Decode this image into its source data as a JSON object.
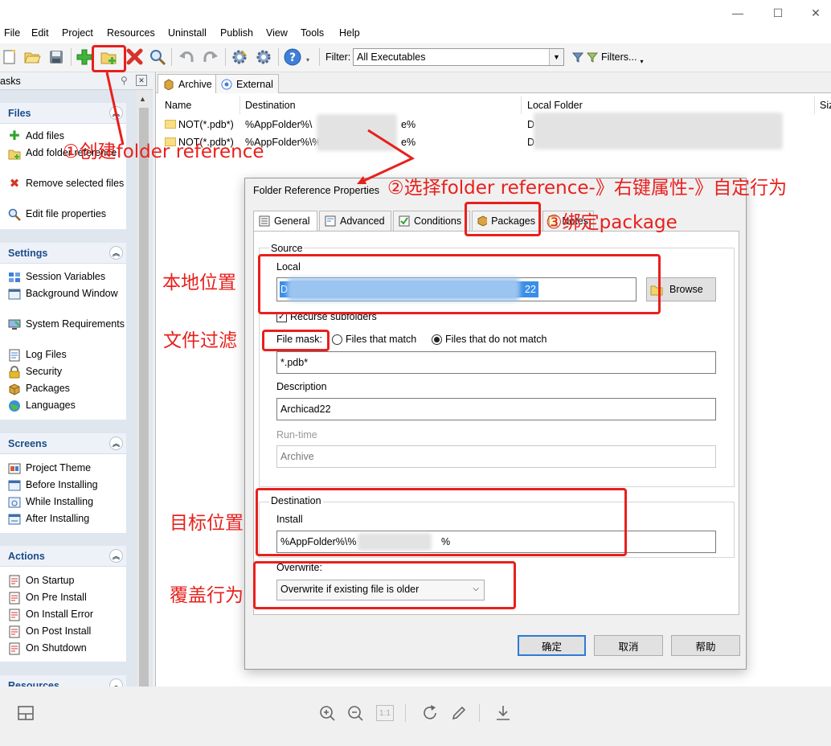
{
  "window": {
    "minimize_glyph": "—",
    "maximize_glyph": "☐",
    "close_glyph": "✕"
  },
  "menu": [
    "File",
    "Edit",
    "Project",
    "Resources",
    "Uninstall",
    "Publish",
    "View",
    "Tools",
    "Help"
  ],
  "toolbar": {
    "filter_label": "Filter:",
    "filter_value": "All Executables",
    "filters_button": "Filters...",
    "icons": [
      "new-project-icon",
      "open-icon",
      "save-icon",
      "add-files-icon",
      "add-folder-reference-icon",
      "remove-icon",
      "edit-properties-icon",
      "undo-icon",
      "redo-icon",
      "build-icon",
      "settings-icon",
      "help-icon"
    ]
  },
  "sidebar": {
    "header": "asks",
    "groups": {
      "files": {
        "title": "Files",
        "items": [
          "Add files",
          "Add folder reference",
          "Remove selected files",
          "Edit file properties"
        ]
      },
      "settings": {
        "title": "Settings",
        "items": [
          "Session Variables",
          "Background Window",
          "System Requirements",
          "Log Files",
          "Security",
          "Packages",
          "Languages"
        ]
      },
      "screens": {
        "title": "Screens",
        "items": [
          "Project Theme",
          "Before Installing",
          "While Installing",
          "After Installing"
        ]
      },
      "actions": {
        "title": "Actions",
        "items": [
          "On Startup",
          "On Pre Install",
          "On Install Error",
          "On Post Install",
          "On Shutdown"
        ]
      },
      "resources": {
        "title": "Resources"
      }
    }
  },
  "main": {
    "tabs": [
      "Archive",
      "External"
    ],
    "columns": [
      "Name",
      "Destination",
      "Local Folder",
      "Siz"
    ],
    "rows": [
      {
        "name": "NOT(*.pdb*)",
        "destination_start": "%AppFolder%\\",
        "destination_end": "e%",
        "local_start": "D"
      },
      {
        "name": "NOT(*.pdb*)",
        "destination_start": "%AppFolder%\\%",
        "destination_end": "e%",
        "local_start": "D"
      }
    ]
  },
  "dialog": {
    "title": "Folder Reference Properties",
    "tabs": [
      "General",
      "Advanced",
      "Conditions",
      "Packages",
      "Notes"
    ],
    "source": {
      "group_label": "Source",
      "local_label": "Local",
      "local_value_start": "D",
      "local_value_end": "22",
      "browse_label": "Browse",
      "recurse_label": "Recurse subfolders",
      "recurse_checked": true,
      "file_mask_label": "File mask:",
      "radio_match": "Files that match",
      "radio_not_match": "Files that do not match",
      "selected_radio": "Files that do not match",
      "file_mask_value": "*.pdb*",
      "description_label": "Description",
      "description_value": "Archicad22",
      "runtime_label": "Run-time",
      "runtime_value": "Archive"
    },
    "destination": {
      "group_label": "Destination",
      "install_label": "Install",
      "install_value_start": "%AppFolder%\\%",
      "install_value_end": "%"
    },
    "overwrite": {
      "label": "Overwrite:",
      "value": "Overwrite if existing file is older"
    },
    "buttons": {
      "ok": "确定",
      "cancel": "取消",
      "help": "帮助"
    }
  },
  "annotations": {
    "step1": "①创建folder reference",
    "step2": "②选择folder reference-》右键属性-》自定行为",
    "step3": "③绑定package",
    "local_position": "本地位置",
    "file_filter": "文件过滤",
    "target_position": "目标位置",
    "overwrite_behavior": "覆盖行为",
    "color": "#e8201c"
  },
  "viewer": {
    "actual_size_label": "1:1",
    "icons": [
      "layout-icon",
      "zoom-in-icon",
      "zoom-out-icon",
      "actual-size-icon",
      "rotate-icon",
      "edit-pen-icon",
      "download-icon"
    ]
  }
}
